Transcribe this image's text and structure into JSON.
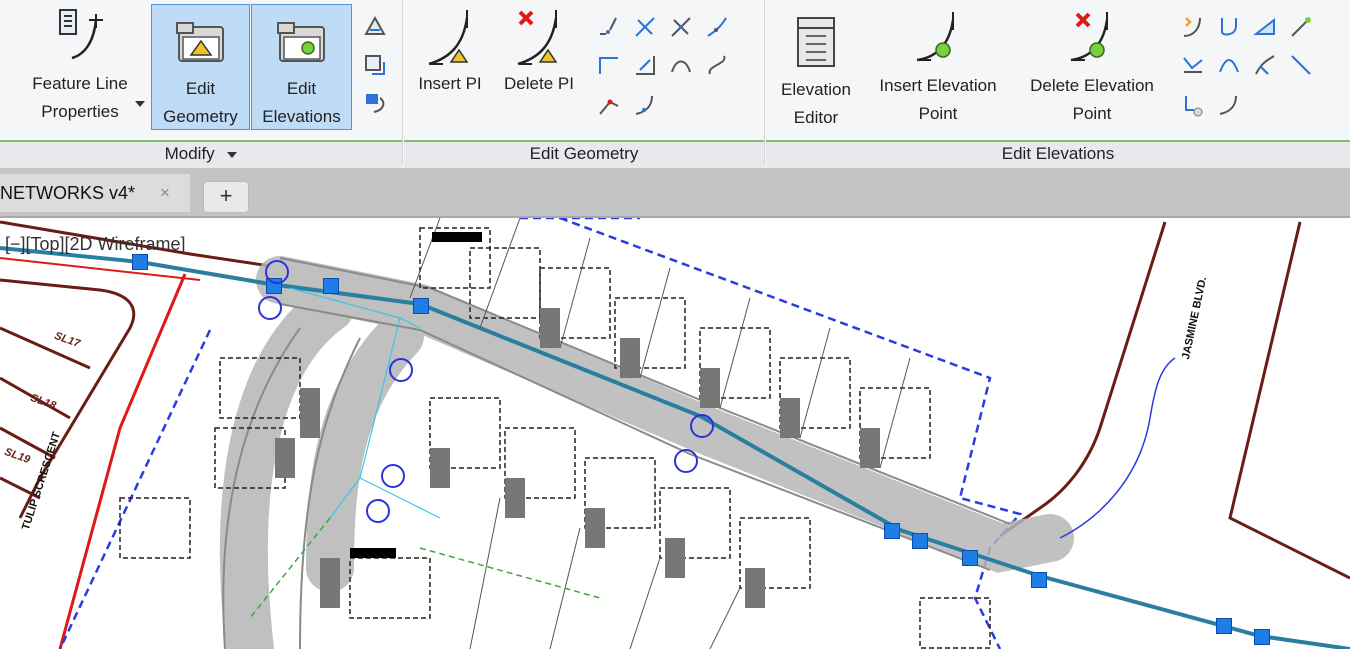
{
  "ribbon": {
    "modify_panel": {
      "title": "Modify",
      "buttons": [
        {
          "line1": "Feature Line",
          "line2": "Properties",
          "icon": "feature-line-properties-icon"
        },
        {
          "line1": "Edit",
          "line2": "Geometry",
          "icon": "edit-geometry-icon",
          "active": true
        },
        {
          "line1": "Edit",
          "line2": "Elevations",
          "icon": "edit-elevations-icon",
          "active": true
        }
      ]
    },
    "edit_geometry_panel": {
      "title": "Edit Geometry",
      "buttons": [
        {
          "label": "Insert PI",
          "icon": "insert-pi-icon"
        },
        {
          "label": "Delete PI",
          "icon": "delete-pi-icon"
        }
      ]
    },
    "edit_elevations_panel": {
      "title": "Edit Elevations",
      "buttons": [
        {
          "line1": "Elevation",
          "line2": "Editor",
          "icon": "elevation-editor-icon"
        },
        {
          "line1": "Insert Elevation",
          "line2": "Point",
          "icon": "insert-elevation-point-icon"
        },
        {
          "line1": "Delete Elevation",
          "line2": "Point",
          "icon": "delete-elevation-point-icon"
        }
      ]
    }
  },
  "tabs": {
    "active_tab": "NETWORKS v4*",
    "close_glyph": "×",
    "new_tab_glyph": "+"
  },
  "viewport": {
    "label": "[−][Top][2D Wireframe]",
    "lot_labels": [
      "SL17",
      "SL18",
      "SL19"
    ],
    "street_labels": [
      "TULIP SCRESCENT",
      "JASMINE BLVD."
    ]
  },
  "colors": {
    "ribbon_bg": "#f5f6f7",
    "panel_title_accent": "#7fbf6a",
    "active_button": "#bfdcf6",
    "grip_marker": "#1e7ee6",
    "ring": "#2b32d8",
    "property_line": "#6b1d15",
    "red_line": "#e01818",
    "boundary": "#2a3be0"
  }
}
